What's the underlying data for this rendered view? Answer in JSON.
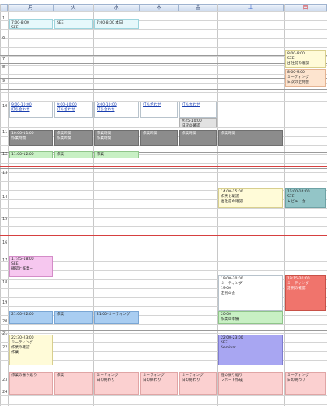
{
  "header": {
    "days": [
      {
        "label": "月",
        "kind": "weekday"
      },
      {
        "label": "火",
        "kind": "weekday"
      },
      {
        "label": "水",
        "kind": "weekday"
      },
      {
        "label": "木",
        "kind": "weekday"
      },
      {
        "label": "金",
        "kind": "weekday"
      },
      {
        "label": "土",
        "kind": "sat"
      },
      {
        "label": "日",
        "kind": "sun"
      }
    ]
  },
  "hours": [
    "1",
    "6",
    "7",
    "8",
    "9",
    "10",
    "11",
    "12",
    "13",
    "14",
    "15",
    "16",
    "17",
    "18",
    "19",
    "20",
    "21",
    "22",
    "23",
    "24"
  ],
  "events": [
    {
      "col": 0,
      "row": 0,
      "style": "c-cyan",
      "lines": [
        "7:00-8:00",
        "SEE"
      ]
    },
    {
      "col": 1,
      "row": 0,
      "style": "c-cyan",
      "lines": [
        "SEE"
      ]
    },
    {
      "col": 2,
      "row": 0,
      "style": "c-cyan",
      "lines": [
        "7:00-8:00 本日"
      ]
    },
    {
      "col": 6,
      "row": 1,
      "style": "c-yellow",
      "lines": [
        "8:00-9:00",
        "SEE",
        "出社前の確認"
      ]
    },
    {
      "col": 6,
      "row": 2,
      "style": "c-peach",
      "lines": [
        "8:00-9:00",
        "ミーティング",
        "日次の定例会"
      ]
    },
    {
      "col": 0,
      "row": 3,
      "style": "c-white",
      "lines": [
        "9:00-10:00",
        "打ち合わせ"
      ],
      "link": true
    },
    {
      "col": 1,
      "row": 3,
      "style": "c-white",
      "lines": [
        "9:00-10:00",
        "打ち合わせ"
      ],
      "link": true
    },
    {
      "col": 2,
      "row": 3,
      "style": "c-white",
      "lines": [
        "9:00-10:00",
        "打ち合わせ"
      ],
      "link": true
    },
    {
      "col": 3,
      "row": 3,
      "style": "c-white",
      "lines": [
        "打ち合わせ"
      ],
      "link": true
    },
    {
      "col": 4,
      "row": 3,
      "style": "c-white",
      "lines": [
        "打ち合わせ"
      ],
      "link": true
    },
    {
      "col": 4,
      "row": 4,
      "style": "c-lgray",
      "lines": [
        "9:45-10:00",
        "日次の確認"
      ]
    },
    {
      "col": 0,
      "row": 5,
      "style": "c-dgray",
      "lines": [
        "10:00-11:00",
        "作業時間"
      ]
    },
    {
      "col": 1,
      "row": 5,
      "style": "c-dgray",
      "lines": [
        "作業時間",
        "作業時間"
      ]
    },
    {
      "col": 2,
      "row": 5,
      "style": "c-dgray",
      "lines": [
        "作業時間",
        "作業時間"
      ]
    },
    {
      "col": 3,
      "row": 5,
      "style": "c-dgray",
      "lines": [
        "作業時間"
      ]
    },
    {
      "col": 4,
      "row": 5,
      "style": "c-dgray",
      "lines": [
        "作業時間"
      ]
    },
    {
      "col": 5,
      "row": 5,
      "style": "c-dgray",
      "lines": [
        "作業時間"
      ]
    },
    {
      "col": 0,
      "row": 6,
      "style": "c-green",
      "lines": [
        "11:00-12:00"
      ]
    },
    {
      "col": 1,
      "row": 6,
      "style": "c-green",
      "lines": [
        "作業"
      ]
    },
    {
      "col": 2,
      "row": 6,
      "style": "c-green",
      "lines": [
        "作業"
      ]
    },
    {
      "col": 5,
      "row": 7,
      "style": "c-yellow",
      "lines": [
        "14:00-15:00",
        "作業と確認",
        "出社前の確認"
      ]
    },
    {
      "col": 6,
      "row": 7,
      "style": "c-teal",
      "lines": [
        "15:00-16:00",
        "SEE",
        "レビュー会"
      ]
    },
    {
      "col": 0,
      "row": 8,
      "style": "c-pink",
      "lines": [
        "17:45-18:00",
        "SEE",
        "確認と作業ー"
      ]
    },
    {
      "col": 5,
      "row": 9,
      "style": "c-white",
      "lines": [
        "19:00-20:00",
        "ミーティング",
        "19:00",
        "定例の会"
      ]
    },
    {
      "col": 6,
      "row": 9,
      "style": "c-red",
      "lines": [
        "19:15-20:00",
        "ミーティング",
        "定例の確認"
      ]
    },
    {
      "col": 5,
      "row": 10,
      "style": "c-green",
      "lines": [
        "20:00",
        "作業の準備"
      ]
    },
    {
      "col": 0,
      "row": 10,
      "style": "c-ltblue",
      "lines": [
        "21:00-22:00"
      ]
    },
    {
      "col": 1,
      "row": 10,
      "style": "c-ltblue",
      "lines": [
        "作業"
      ]
    },
    {
      "col": 2,
      "row": 10,
      "style": "c-ltblue",
      "lines": [
        "21:00-ミーティング"
      ]
    },
    {
      "col": 5,
      "row": 11,
      "style": "c-lilac",
      "lines": [
        "22:00-23:00",
        "SEE",
        "Seminar"
      ]
    },
    {
      "col": 0,
      "row": 11,
      "style": "c-yellow",
      "lines": [
        "22:30-23:00",
        "ミーティング",
        "作業の確認",
        "作業"
      ]
    },
    {
      "col": 0,
      "row": 12,
      "style": "c-rose",
      "lines": [
        "作業の振り返り"
      ]
    },
    {
      "col": 1,
      "row": 12,
      "style": "c-rose",
      "lines": [
        "作業"
      ]
    },
    {
      "col": 2,
      "row": 12,
      "style": "c-rose",
      "lines": [
        "ミーティング",
        "日の終わり"
      ]
    },
    {
      "col": 3,
      "row": 12,
      "style": "c-rose",
      "lines": [
        "ミーティング",
        "日の終わり"
      ]
    },
    {
      "col": 4,
      "row": 12,
      "style": "c-rose",
      "lines": [
        "ミーティング",
        "日の終わり"
      ]
    },
    {
      "col": 5,
      "row": 12,
      "style": "c-rose",
      "lines": [
        "週の振り返り",
        "レポート作成"
      ]
    },
    {
      "col": 6,
      "row": 12,
      "style": "c-rose",
      "lines": [
        "ミーティング",
        "日の終わり"
      ]
    }
  ]
}
